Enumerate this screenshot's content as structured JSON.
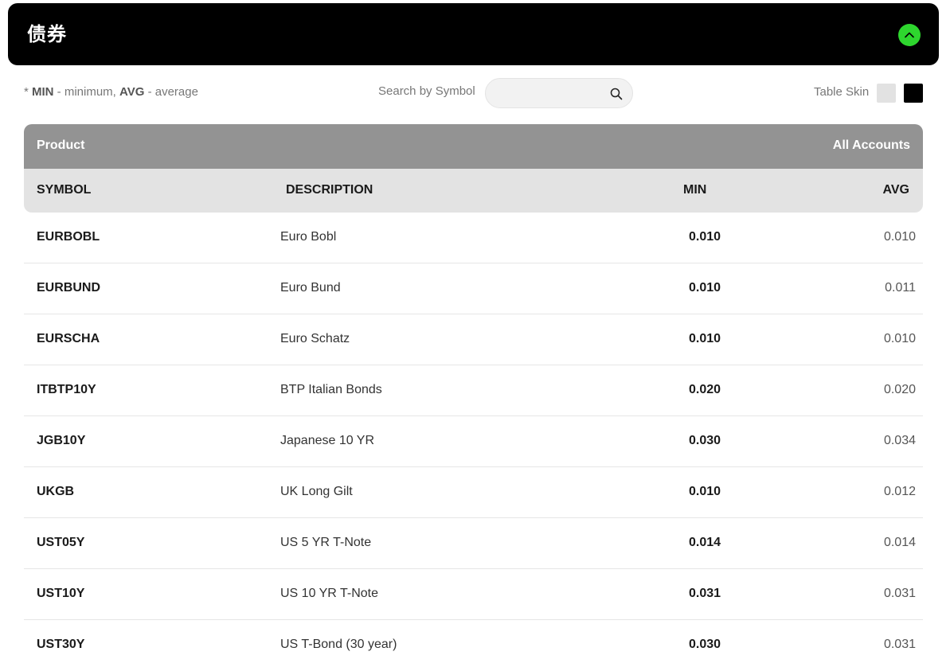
{
  "section": {
    "title": "债券"
  },
  "legend": {
    "prefix": "* ",
    "min_key": "MIN",
    "min_text": " - minimum, ",
    "avg_key": "AVG",
    "avg_text": " - average"
  },
  "search": {
    "label": "Search by Symbol",
    "value": "",
    "placeholder": ""
  },
  "skin": {
    "label": "Table Skin",
    "options": [
      "light",
      "dark"
    ],
    "colors": {
      "light": "#e2e2e2",
      "dark": "#000000"
    }
  },
  "table": {
    "group_header": {
      "product": "Product",
      "accounts": "All Accounts"
    },
    "columns": [
      "SYMBOL",
      "DESCRIPTION",
      "MIN",
      "AVG"
    ],
    "rows": [
      {
        "symbol": "EURBOBL",
        "description": "Euro Bobl",
        "min": "0.010",
        "avg": "0.010"
      },
      {
        "symbol": "EURBUND",
        "description": "Euro Bund",
        "min": "0.010",
        "avg": "0.011"
      },
      {
        "symbol": "EURSCHA",
        "description": "Euro Schatz",
        "min": "0.010",
        "avg": "0.010"
      },
      {
        "symbol": "ITBTP10Y",
        "description": "BTP Italian Bonds",
        "min": "0.020",
        "avg": "0.020"
      },
      {
        "symbol": "JGB10Y",
        "description": "Japanese 10 YR",
        "min": "0.030",
        "avg": "0.034"
      },
      {
        "symbol": "UKGB",
        "description": "UK Long Gilt",
        "min": "0.010",
        "avg": "0.012"
      },
      {
        "symbol": "UST05Y",
        "description": "US 5 YR T-Note",
        "min": "0.014",
        "avg": "0.014"
      },
      {
        "symbol": "UST10Y",
        "description": "US 10 YR T-Note",
        "min": "0.031",
        "avg": "0.031"
      },
      {
        "symbol": "UST30Y",
        "description": "US T-Bond (30 year)",
        "min": "0.030",
        "avg": "0.031"
      }
    ]
  },
  "colors": {
    "header_bg": "#000000",
    "accent": "#2ed62e",
    "group_header_bg": "#939393",
    "column_header_bg": "#e3e3e3"
  }
}
